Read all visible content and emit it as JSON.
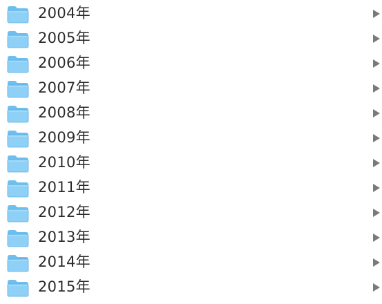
{
  "folders": [
    {
      "name": "2004年",
      "icon": "folder-icon",
      "expand_icon": "disclosure-triangle-right-icon"
    },
    {
      "name": "2005年",
      "icon": "folder-icon",
      "expand_icon": "disclosure-triangle-right-icon"
    },
    {
      "name": "2006年",
      "icon": "folder-icon",
      "expand_icon": "disclosure-triangle-right-icon"
    },
    {
      "name": "2007年",
      "icon": "folder-icon",
      "expand_icon": "disclosure-triangle-right-icon"
    },
    {
      "name": "2008年",
      "icon": "folder-icon",
      "expand_icon": "disclosure-triangle-right-icon"
    },
    {
      "name": "2009年",
      "icon": "folder-icon",
      "expand_icon": "disclosure-triangle-right-icon"
    },
    {
      "name": "2010年",
      "icon": "folder-icon",
      "expand_icon": "disclosure-triangle-right-icon"
    },
    {
      "name": "2011年",
      "icon": "folder-icon",
      "expand_icon": "disclosure-triangle-right-icon"
    },
    {
      "name": "2012年",
      "icon": "folder-icon",
      "expand_icon": "disclosure-triangle-right-icon"
    },
    {
      "name": "2013年",
      "icon": "folder-icon",
      "expand_icon": "disclosure-triangle-right-icon"
    },
    {
      "name": "2014年",
      "icon": "folder-icon",
      "expand_icon": "disclosure-triangle-right-icon"
    },
    {
      "name": "2015年",
      "icon": "folder-icon",
      "expand_icon": "disclosure-triangle-right-icon"
    }
  ],
  "colors": {
    "folder_body": "#8fd0f6",
    "folder_tab": "#6fbfee",
    "folder_edge": "#5aaee2",
    "text": "#2b2b2b",
    "disclosure": "#7a7a7a",
    "background": "#ffffff"
  }
}
